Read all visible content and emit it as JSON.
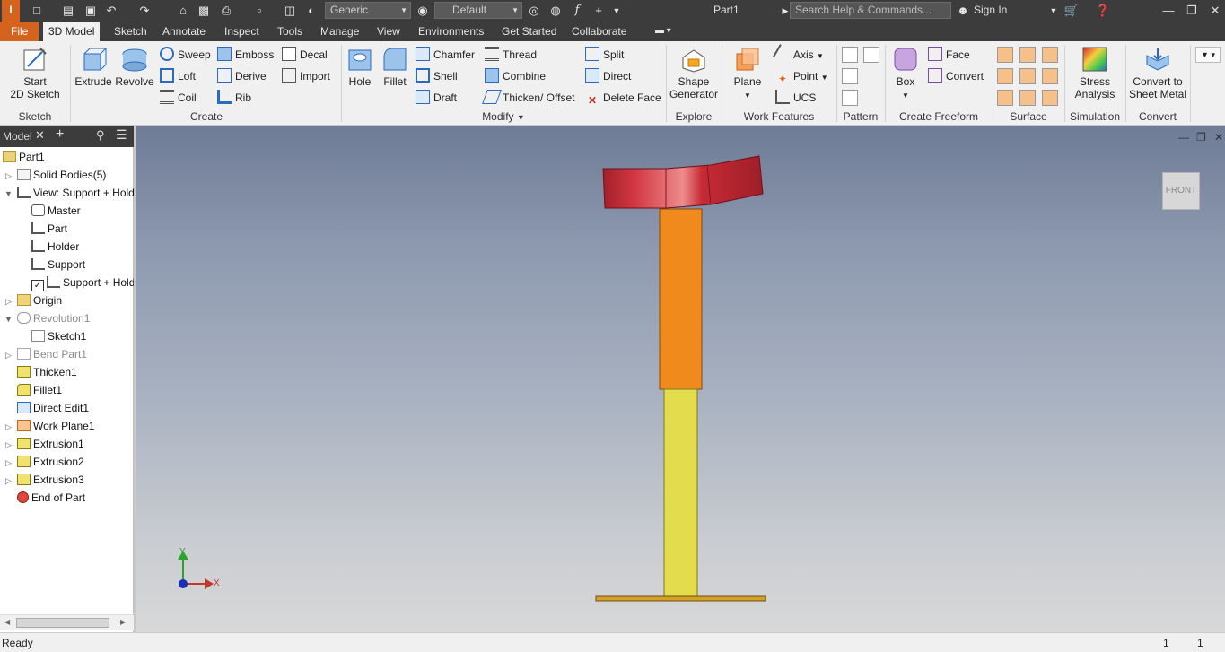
{
  "titlebar": {
    "doc_title": "Part1",
    "appearance_combo": "Generic",
    "material_combo": "Default",
    "help_search_placeholder": "Search Help & Commands...",
    "sign_in": "Sign In"
  },
  "menu": {
    "file": "File",
    "tabs": [
      "3D Model",
      "Sketch",
      "Annotate",
      "Inspect",
      "Tools",
      "Manage",
      "View",
      "Environments",
      "Get Started",
      "Collaborate"
    ],
    "active_tab": "3D Model"
  },
  "ribbon": {
    "sketch": {
      "panel": "Sketch",
      "start_sketch_line1": "Start",
      "start_sketch_line2": "2D Sketch"
    },
    "create": {
      "panel": "Create",
      "extrude": "Extrude",
      "revolve": "Revolve",
      "sweep": "Sweep",
      "loft": "Loft",
      "coil": "Coil",
      "emboss": "Emboss",
      "derive": "Derive",
      "rib": "Rib",
      "decal": "Decal",
      "import": "Import"
    },
    "modify": {
      "panel": "Modify",
      "hole": "Hole",
      "fillet": "Fillet",
      "chamfer": "Chamfer",
      "shell": "Shell",
      "draft": "Draft",
      "thread": "Thread",
      "combine": "Combine",
      "thicken": "Thicken/ Offset",
      "split": "Split",
      "direct": "Direct",
      "delete_face": "Delete Face"
    },
    "explore": {
      "panel": "Explore",
      "shape_gen_line1": "Shape",
      "shape_gen_line2": "Generator"
    },
    "work_features": {
      "panel": "Work Features",
      "plane": "Plane",
      "axis": "Axis",
      "point": "Point",
      "ucs": "UCS"
    },
    "pattern": {
      "panel": "Pattern"
    },
    "freeform": {
      "panel": "Create Freeform",
      "box": "Box",
      "face": "Face",
      "convert": "Convert"
    },
    "surface": {
      "panel": "Surface"
    },
    "simulation": {
      "panel": "Simulation",
      "stress_line1": "Stress",
      "stress_line2": "Analysis"
    },
    "convert": {
      "panel": "Convert",
      "sheet_line1": "Convert to",
      "sheet_line2": "Sheet Metal"
    }
  },
  "browser": {
    "tab": "Model",
    "items": [
      {
        "label": "Part1"
      },
      {
        "label": "Solid Bodies(5)"
      },
      {
        "label": "View: Support + Holder"
      },
      {
        "label": "Master"
      },
      {
        "label": "Part"
      },
      {
        "label": "Holder"
      },
      {
        "label": "Support"
      },
      {
        "label": "Support + Holder"
      },
      {
        "label": "Origin"
      },
      {
        "label": "Revolution1"
      },
      {
        "label": "Sketch1"
      },
      {
        "label": "Bend Part1"
      },
      {
        "label": "Thicken1"
      },
      {
        "label": "Fillet1"
      },
      {
        "label": "Direct Edit1"
      },
      {
        "label": "Work Plane1"
      },
      {
        "label": "Extrusion1"
      },
      {
        "label": "Extrusion2"
      },
      {
        "label": "Extrusion3"
      },
      {
        "label": "End of Part"
      }
    ]
  },
  "viewport": {
    "viewcube_face": "FRONT",
    "triad_y": "Y",
    "triad_x": "X",
    "colors": {
      "top_part": "#c8303a",
      "orange_block": "#f08a1c",
      "yellow_post": "#e3dc4c",
      "base_plate": "#d4a028"
    }
  },
  "status": {
    "text": "Ready",
    "count1": "1",
    "count2": "1"
  }
}
